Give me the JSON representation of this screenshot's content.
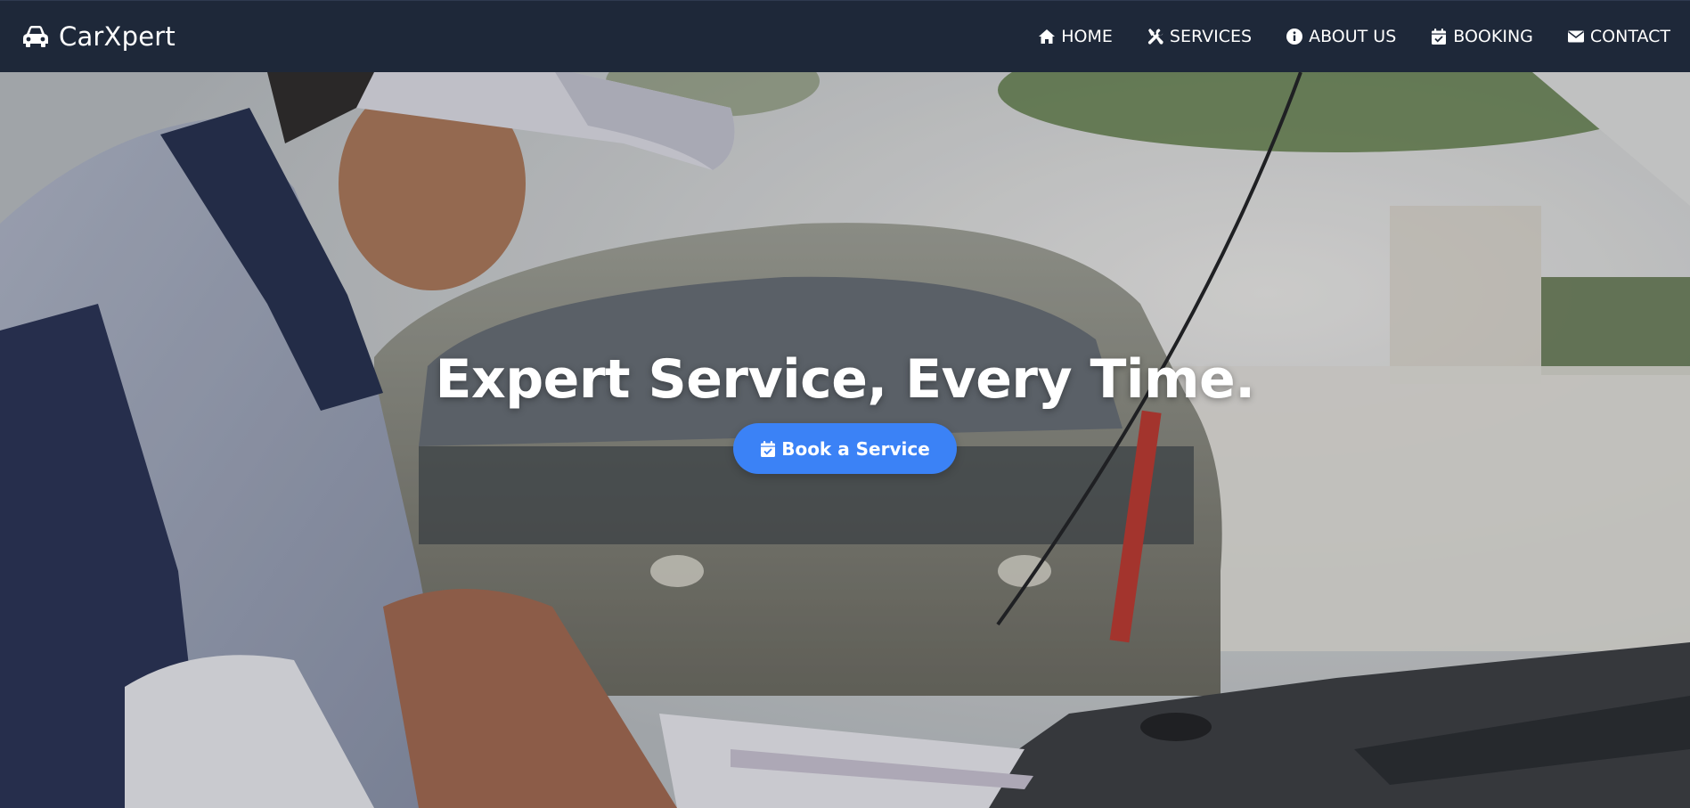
{
  "brand": {
    "name": "CarXpert",
    "icon": "car-icon"
  },
  "nav": {
    "items": [
      {
        "label": "HOME",
        "icon": "home-icon"
      },
      {
        "label": "SERVICES",
        "icon": "tools-icon"
      },
      {
        "label": "ABOUT US",
        "icon": "info-icon"
      },
      {
        "label": "BOOKING",
        "icon": "calendar-check-icon"
      },
      {
        "label": "CONTACT",
        "icon": "envelope-icon"
      }
    ]
  },
  "hero": {
    "title": "Expert Service, Every Time.",
    "cta_label": "Book a Service",
    "cta_icon": "calendar-check-icon",
    "image": "mechanic-inspecting-car-engine-photo"
  },
  "colors": {
    "navbar": "#1e2839",
    "accent": "#3b82f6",
    "text": "#ffffff"
  }
}
